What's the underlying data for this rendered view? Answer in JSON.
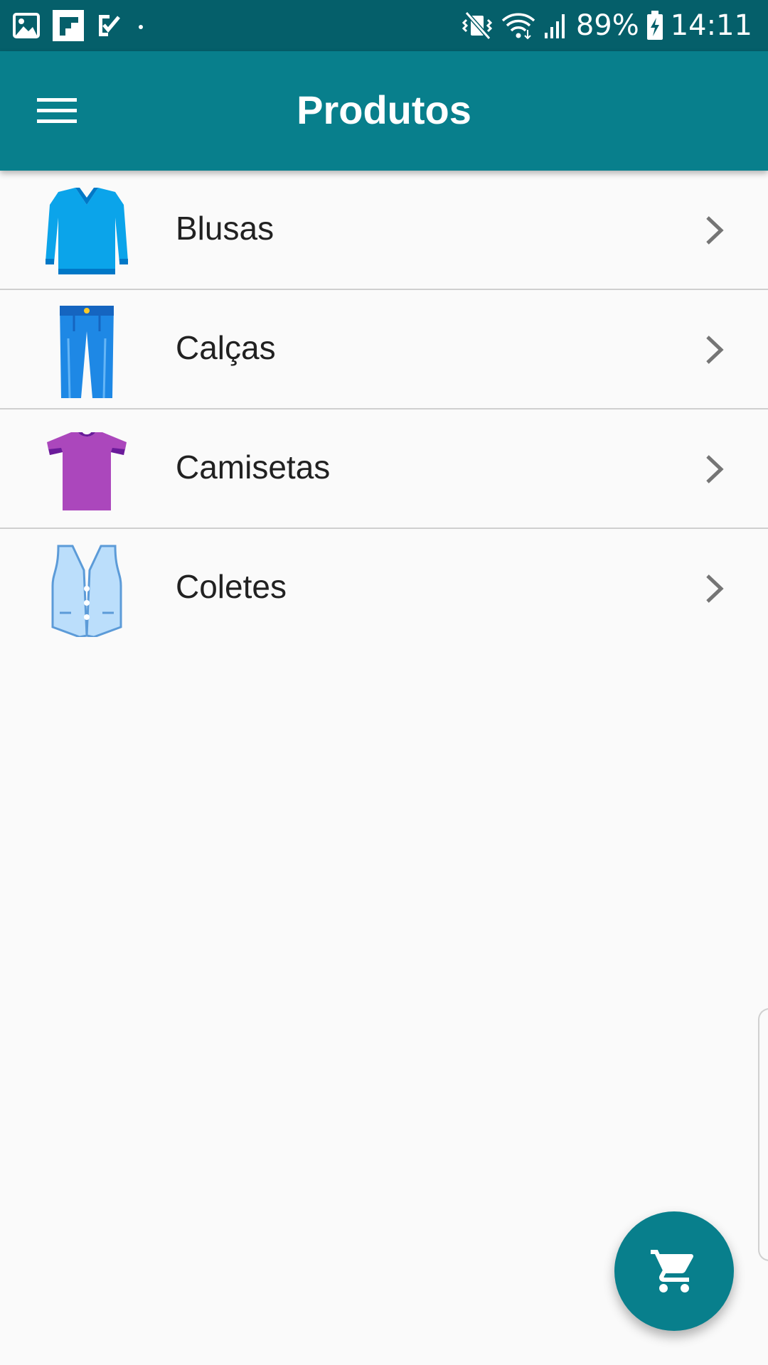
{
  "status_bar": {
    "battery_percent": "89%",
    "time": "14:11",
    "left_icons": [
      "gallery-icon",
      "flipboard-icon",
      "task-check-icon",
      "notification-dot-icon"
    ],
    "right_icons": [
      "vibrate-mute-icon",
      "wifi-icon",
      "signal-icon",
      "battery-charging-icon"
    ]
  },
  "app_bar": {
    "title": "Produtos",
    "menu_icon": "hamburger-menu-icon",
    "background_color": "#087f8c"
  },
  "products": [
    {
      "label": "Blusas",
      "icon": "sweater-icon"
    },
    {
      "label": "Calças",
      "icon": "jeans-icon"
    },
    {
      "label": "Camisetas",
      "icon": "tshirt-icon"
    },
    {
      "label": "Coletes",
      "icon": "vest-icon"
    }
  ],
  "fab": {
    "icon": "shopping-cart-icon",
    "color": "#087f8c"
  },
  "colors": {
    "status_bar": "#055f6a",
    "primary": "#087f8c",
    "background": "#fafafa",
    "divider": "#cfcfcf"
  }
}
